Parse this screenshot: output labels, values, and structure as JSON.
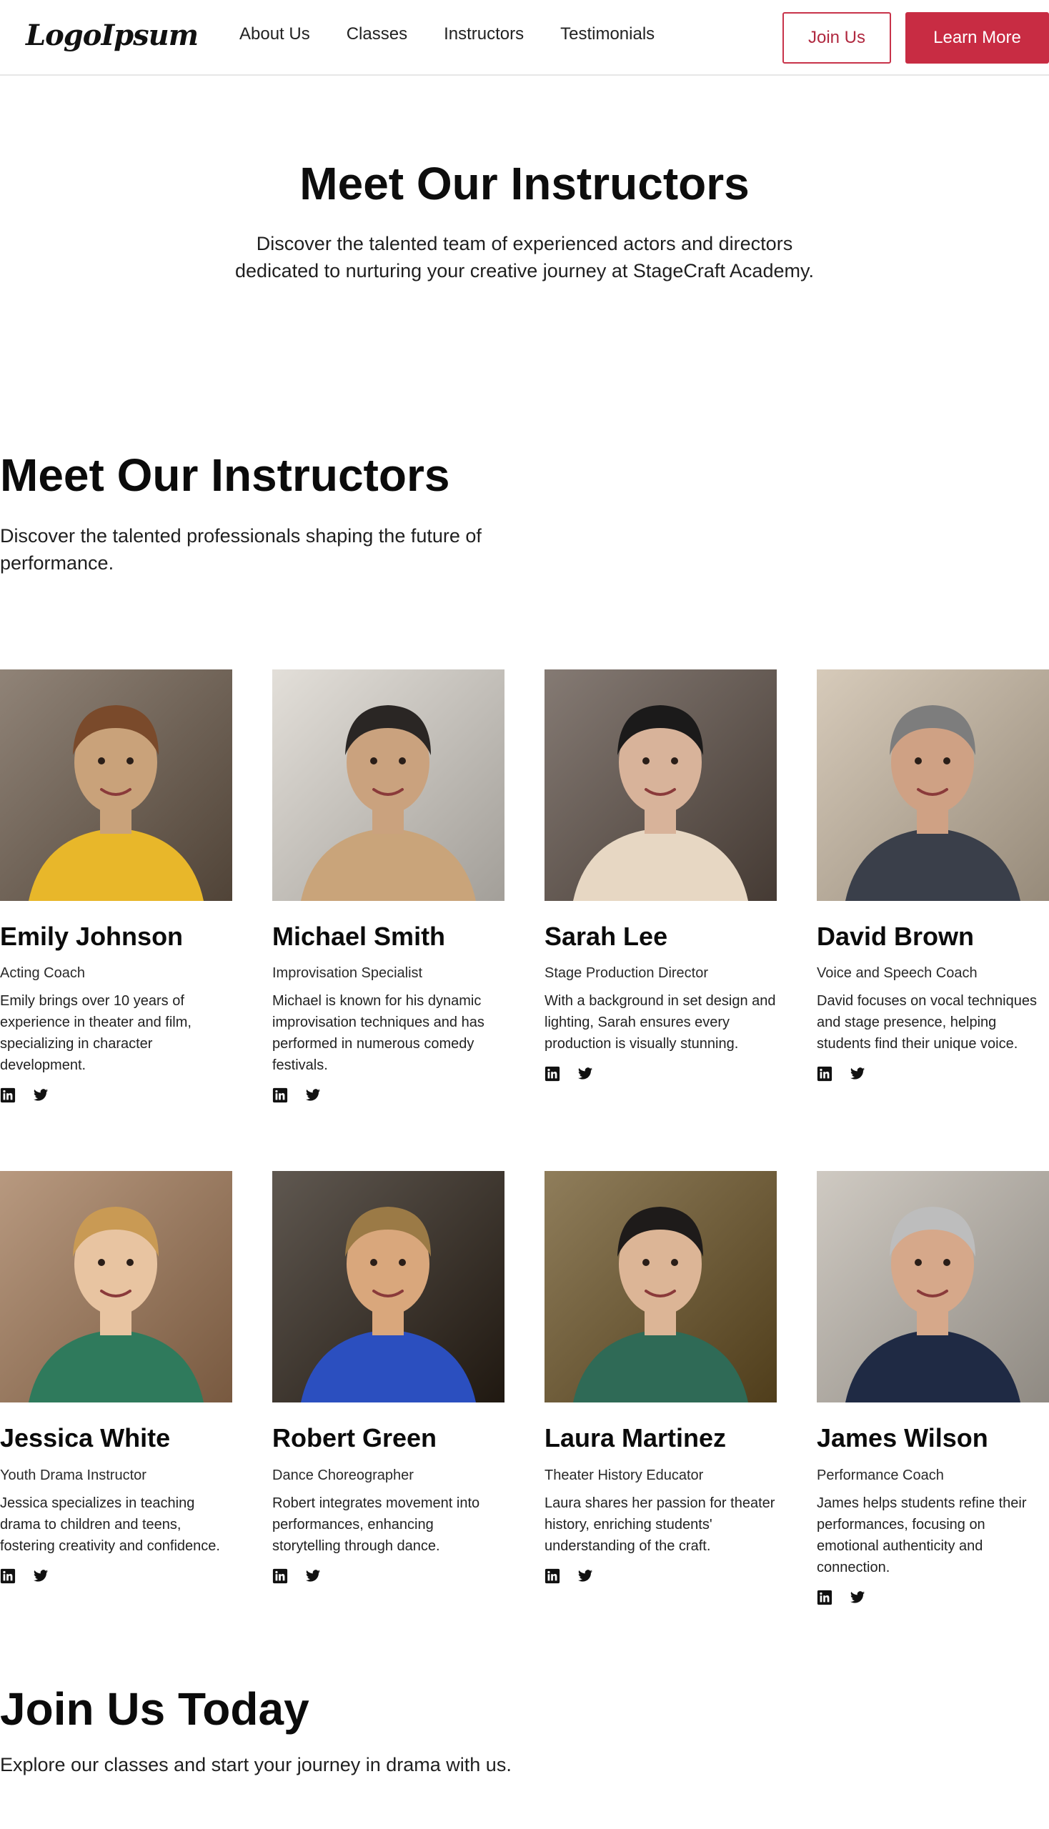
{
  "header": {
    "logo": "LogoIpsum",
    "nav": [
      "About Us",
      "Classes",
      "Instructors",
      "Testimonials"
    ],
    "join_label": "Join Us",
    "learn_label": "Learn More",
    "accent_color": "#c82c43"
  },
  "hero": {
    "title": "Meet Our Instructors",
    "subtitle": "Discover the talented team of experienced actors and directors dedicated to nurturing your creative journey at StageCraft Academy."
  },
  "instructors_section": {
    "title": "Meet Our Instructors",
    "subtitle": "Discover the talented professionals shaping the future of performance."
  },
  "instructors": [
    {
      "name": "Emily Johnson",
      "role": "Acting Coach",
      "bio": "Emily brings over 10 years of experience in theater and film, specializing in character development.",
      "photo_icon": "portrait-photo"
    },
    {
      "name": "Michael Smith",
      "role": "Improvisation Specialist",
      "bio": "Michael is known for his dynamic improvisation techniques and has performed in numerous comedy festivals.",
      "photo_icon": "portrait-photo"
    },
    {
      "name": "Sarah Lee",
      "role": "Stage Production Director",
      "bio": "With a background in set design and lighting, Sarah ensures every production is visually stunning.",
      "photo_icon": "portrait-photo"
    },
    {
      "name": "David Brown",
      "role": "Voice and Speech Coach",
      "bio": "David focuses on vocal techniques and stage presence, helping students find their unique voice.",
      "photo_icon": "portrait-photo"
    },
    {
      "name": "Jessica White",
      "role": "Youth Drama Instructor",
      "bio": "Jessica specializes in teaching drama to children and teens, fostering creativity and confidence.",
      "photo_icon": "portrait-photo"
    },
    {
      "name": "Robert Green",
      "role": "Dance Choreographer",
      "bio": "Robert integrates movement into performances, enhancing storytelling through dance.",
      "photo_icon": "portrait-photo"
    },
    {
      "name": "Laura Martinez",
      "role": "Theater History Educator",
      "bio": "Laura shares her passion for theater history, enriching students' understanding of the craft.",
      "photo_icon": "portrait-photo"
    },
    {
      "name": "James Wilson",
      "role": "Performance Coach",
      "bio": "James helps students refine their performances, focusing on emotional authenticity and connection.",
      "photo_icon": "portrait-photo"
    }
  ],
  "social_icons": [
    "linkedin-icon",
    "twitter-icon"
  ],
  "join": {
    "title": "Join Us Today",
    "subtitle": "Explore our classes and start your journey in drama with us."
  }
}
